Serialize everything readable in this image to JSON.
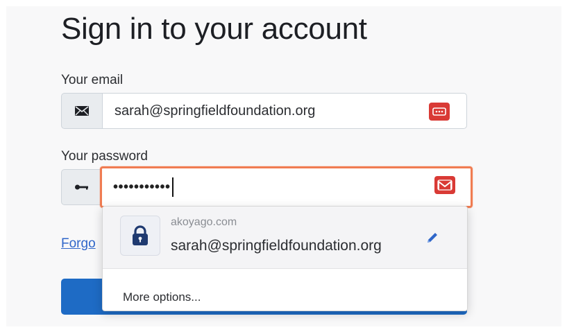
{
  "page": {
    "title": "Sign in to your account"
  },
  "email": {
    "label": "Your email",
    "value": "sarah@springfieldfoundation.org",
    "icon": "envelope-icon"
  },
  "password": {
    "label": "Your password",
    "masked_value": "•••••••••••",
    "icon": "key-icon"
  },
  "links": {
    "forgot": "Forgo"
  },
  "autofill": {
    "site": "akoyago.com",
    "username": "sarah@springfieldfoundation.org",
    "more_options": "More options...",
    "lock_icon": "lock-icon",
    "edit_icon": "pencil-icon"
  },
  "colors": {
    "accent": "#1e6bc5",
    "password_manager": "#d93a35",
    "focus_ring": "#f07c52",
    "lock_tile_icon": "#1f3a70"
  }
}
